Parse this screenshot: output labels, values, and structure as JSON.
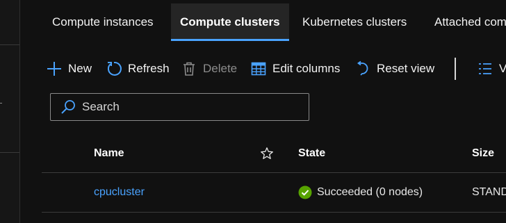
{
  "tabs": [
    {
      "label": "Compute instances",
      "active": false
    },
    {
      "label": "Compute clusters",
      "active": true
    },
    {
      "label": "Kubernetes clusters",
      "active": false
    },
    {
      "label": "Attached compute",
      "active": false
    }
  ],
  "toolbar": {
    "new_label": "New",
    "refresh_label": "Refresh",
    "delete_label": "Delete",
    "edit_columns_label": "Edit columns",
    "reset_view_label": "Reset view",
    "view_label": "View"
  },
  "search": {
    "placeholder": "Search",
    "value": ""
  },
  "table": {
    "columns": {
      "name": "Name",
      "state": "State",
      "size": "Size"
    },
    "rows": [
      {
        "name": "cpucluster",
        "state": "Succeeded (0 nodes)",
        "size": "STANDARD"
      }
    ]
  },
  "icons": {
    "new": "plus-icon",
    "refresh": "refresh-icon",
    "delete": "trash-icon",
    "edit_columns": "table-columns-icon",
    "reset_view": "undo-icon",
    "view": "list-view-icon",
    "search": "search-icon",
    "favorite": "star-icon",
    "status": "success-check-icon"
  },
  "colors": {
    "accent": "#4aa3ff",
    "success": "#57a300",
    "background": "#111111"
  }
}
